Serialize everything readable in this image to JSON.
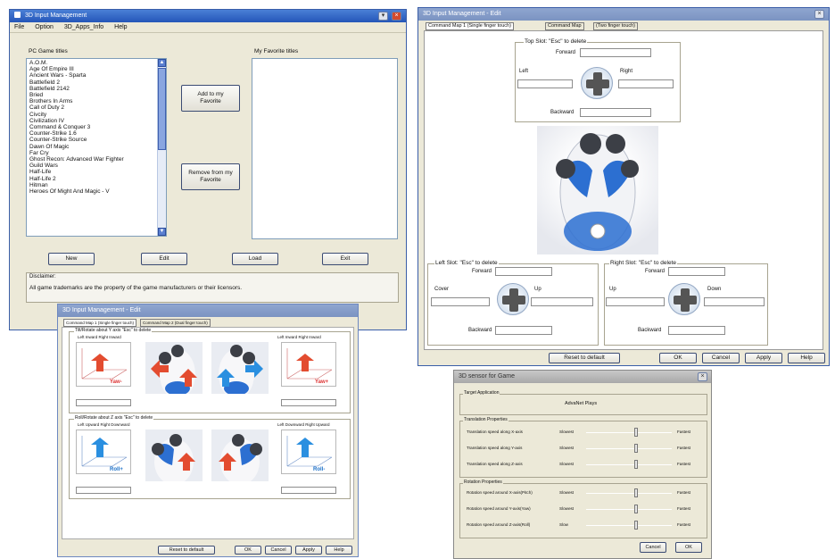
{
  "main_window": {
    "title": "3D Input Management",
    "menu": [
      "File",
      "Option",
      "3D_Apps_Info",
      "Help"
    ],
    "pc_game_titles_label": "PC Game titles",
    "games": [
      "A.O.M.",
      "Age Of Empire III",
      "Ancient Wars - Sparta",
      "Battlefield 2",
      "Battlefield 2142",
      "Bried",
      "Brothers In Arms",
      "Call of Duty 2",
      "Civcity",
      "Civilization IV",
      "Command & Conquer 3",
      "Counter-Strike 1.6",
      "Counter-Strike Source",
      "Dawn Of Magic",
      "Far Cry",
      "Ghost Recon: Advanced War Fighter",
      "Guild Wars",
      "Half-Life",
      "Half-Life 2",
      "Hitman",
      "Heroes Of Might And Magic - V"
    ],
    "favorites_label": "My Favorite titles",
    "add_button": "Add to my Favorite",
    "remove_button": "Remove from my Favorite",
    "buttons": {
      "new": "New",
      "edit": "Edit",
      "load": "Load",
      "exit": "Exit"
    },
    "disclaimer_label": "Disclaimer:",
    "disclaimer_text": "All game trademarks are the property of the game manufacturers or their licensors."
  },
  "button_window": {
    "title": "3D Input Management - Edit",
    "tabs": [
      "Command Map 1 (Single finger touch)",
      "Command Map",
      "(Two finger touch)"
    ],
    "top_group_label": "Top Slot: \"Esc\" to delete",
    "left_group_label": "Left Slot: \"Esc\" to delete",
    "right_group_label": "Right Slot: \"Esc\" to delete",
    "top": {
      "forward": "Forward",
      "left": "Left",
      "right": "Right",
      "backward": "Backward"
    },
    "left_slot": {
      "forward": "Forward",
      "cover": "Cover",
      "up": "Up",
      "backward": "Backward"
    },
    "right_slot": {
      "forward": "Forward",
      "up": "Up",
      "down": "Down",
      "backward": "Backward"
    },
    "reset_button": "Reset to default",
    "ok_button": "OK",
    "cancel_button": "Cancel",
    "apply_button": "Apply",
    "help_button": "Help"
  },
  "tilt_window": {
    "title": "3D Input Management - Edit",
    "tabs": [
      "Command Map 1 (Single finger touch)",
      "Command Map 2 (Dual finger touch)"
    ],
    "upper_group_label": "Tilt/Rotate about Y axis \"Esc\" to delete",
    "upper_left_sub": "Left Inward Right Inward",
    "upper_right_sub": "Left Inward Right Inward",
    "yaw_label": "Yaw-",
    "yaw_label2": "Yaw+",
    "lower_group_label": "Roll/Rotate about Z axis \"Esc\" to delete",
    "lower_left_sub": "Left Upward Right Downward",
    "lower_right_sub": "Left Downward Right Upward",
    "roll_label": "Roll+",
    "roll_label2": "Roll-",
    "reset_button": "Reset to default",
    "ok_button": "OK",
    "cancel_button": "Cancel",
    "apply_button": "Apply",
    "help_button": "Help"
  },
  "sens_window": {
    "title": "3D sensor for Game",
    "target_label": "Target Application",
    "target_value": "AdvaNet Plays",
    "translation_label": "Translation Properties",
    "rotation_label": "Rotation Properties",
    "rows": [
      {
        "label": "Translation speed along X-axis",
        "min": "Slowest",
        "max": "Fastest",
        "level": 0.58
      },
      {
        "label": "Translation speed along Y-axis",
        "min": "Slowest",
        "max": "Fastest",
        "level": 0.58
      },
      {
        "label": "Translation speed along Z-axis",
        "min": "Slowest",
        "max": "Fastest",
        "level": 0.58
      },
      {
        "label": "Rotation speed around X-axis(Pitch)",
        "min": "Slowest",
        "max": "Fastest",
        "level": 0.58
      },
      {
        "label": "Rotation speed around Y-axis(Yaw)",
        "min": "Slowest",
        "max": "Fastest",
        "level": 0.58
      },
      {
        "label": "Rotation speed around Z-axis(Roll)",
        "min": "Slow",
        "max": "Fastest",
        "level": 0.58
      }
    ],
    "cancel_button": "Cancel",
    "ok_button": "OK"
  },
  "colors": {
    "titlebar": "#2456b8",
    "face": "#ece9d8",
    "mouse_blue": "#2c6fd1",
    "arrow_red": "#e34c30",
    "arrow_blue": "#2a8fe0"
  }
}
